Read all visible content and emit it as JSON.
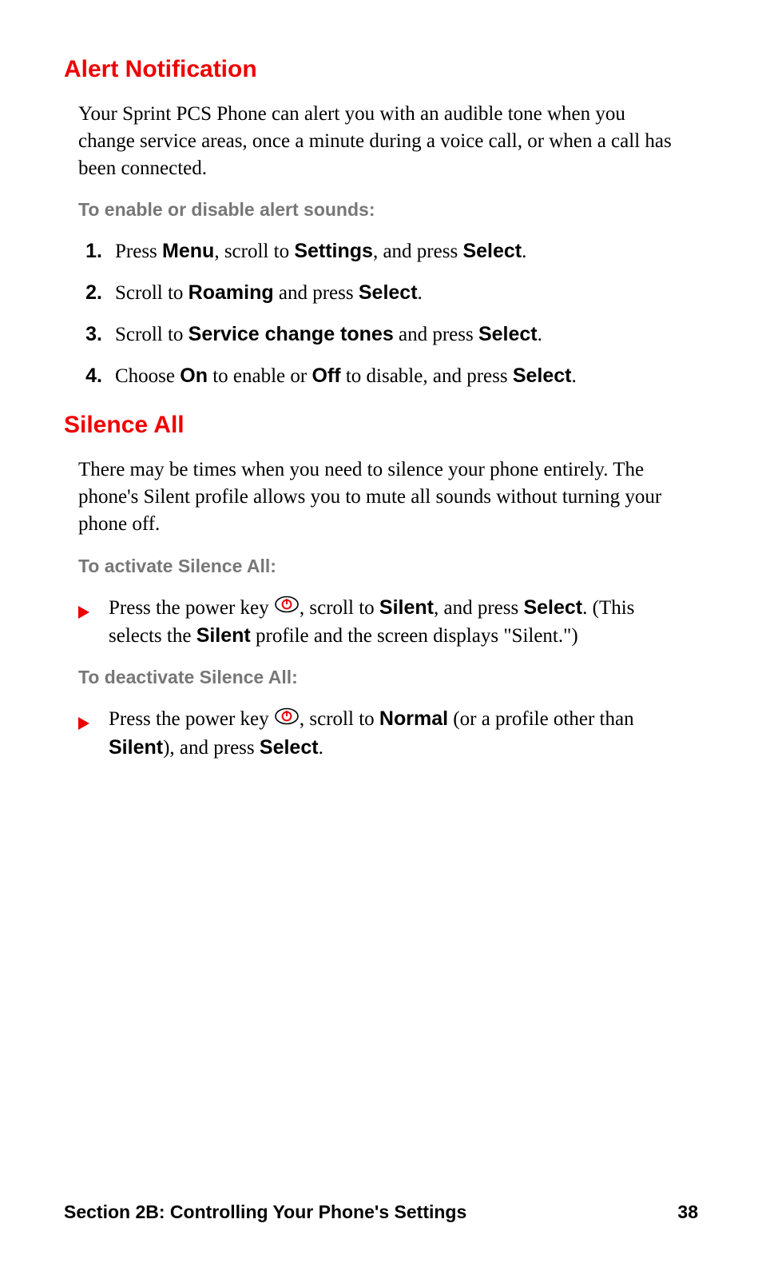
{
  "section1": {
    "heading": "Alert Notification",
    "intro": "Your Sprint PCS Phone can alert you with an audible tone when you change service areas, once a minute during a voice call, or when a call has been connected.",
    "subhead": "To enable or disable alert sounds:",
    "steps": {
      "n1": "1.",
      "s1a": "Press ",
      "s1b": "Menu",
      "s1c": ", scroll to ",
      "s1d": "Settings",
      "s1e": ", and press ",
      "s1f": "Select",
      "s1g": ".",
      "n2": "2.",
      "s2a": "Scroll to ",
      "s2b": "Roaming",
      "s2c": " and press ",
      "s2d": "Select",
      "s2e": ".",
      "n3": "3.",
      "s3a": "Scroll to ",
      "s3b": "Service change tones",
      "s3c": " and press ",
      "s3d": "Select",
      "s3e": ".",
      "n4": "4.",
      "s4a": "Choose ",
      "s4b": "On",
      "s4c": " to enable or ",
      "s4d": "Off",
      "s4e": " to disable, and press ",
      "s4f": "Select",
      "s4g": "."
    }
  },
  "section2": {
    "heading": "Silence All",
    "intro": "There may be times when you need to silence your phone entirely. The phone's Silent profile allows you to mute all sounds without turning your phone off.",
    "sub1": "To activate Silence All:",
    "b1": {
      "a": "Press the power key ",
      "b": ", scroll to ",
      "c": "Silent",
      "d": ", and press ",
      "e": "Select",
      "f": ". (This selects the ",
      "g": "Silent",
      "h": " profile and the screen displays \"Silent.\")"
    },
    "sub2": "To deactivate Silence All:",
    "b2": {
      "a": "Press the power key ",
      "b": ", scroll to ",
      "c": "Normal",
      "d": " (or a profile other than ",
      "e": "Silent",
      "f": "), and press ",
      "g": "Select",
      "h": "."
    }
  },
  "footer": {
    "left": "Section 2B: Controlling Your Phone's Settings",
    "page": "38"
  }
}
